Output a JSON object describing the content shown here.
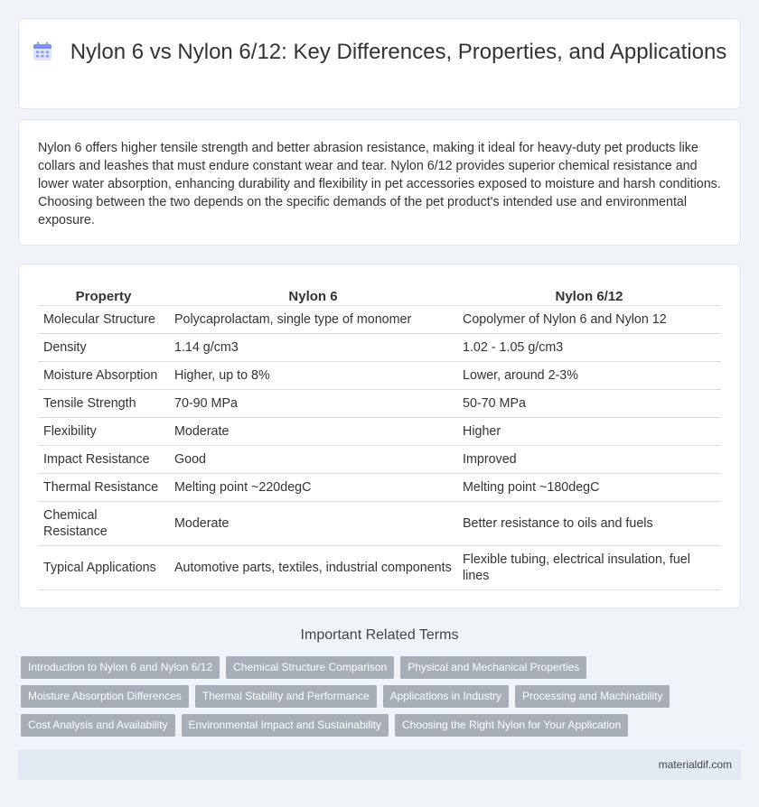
{
  "header": {
    "title": "Nylon 6 vs Nylon 6/12: Key Differences, Properties, and Applications",
    "icon": "calendar-icon"
  },
  "intro": "Nylon 6 offers higher tensile strength and better abrasion resistance, making it ideal for heavy-duty pet products like collars and leashes that must endure constant wear and tear. Nylon 6/12 provides superior chemical resistance and lower water absorption, enhancing durability and flexibility in pet accessories exposed to moisture and harsh conditions. Choosing between the two depends on the specific demands of the pet product's intended use and environmental exposure.",
  "table": {
    "headers": [
      "Property",
      "Nylon 6",
      "Nylon 6/12"
    ],
    "rows": [
      [
        "Molecular Structure",
        "Polycaprolactam, single type of monomer",
        "Copolymer of Nylon 6 and Nylon 12"
      ],
      [
        "Density",
        "1.14 g/cm3",
        "1.02 - 1.05 g/cm3"
      ],
      [
        "Moisture Absorption",
        "Higher, up to 8%",
        "Lower, around 2-3%"
      ],
      [
        "Tensile Strength",
        "70-90 MPa",
        "50-70 MPa"
      ],
      [
        "Flexibility",
        "Moderate",
        "Higher"
      ],
      [
        "Impact Resistance",
        "Good",
        "Improved"
      ],
      [
        "Thermal Resistance",
        "Melting point ~220degC",
        "Melting point ~180degC"
      ],
      [
        "Chemical Resistance",
        "Moderate",
        "Better resistance to oils and fuels"
      ],
      [
        "Typical Applications",
        "Automotive parts, textiles, industrial components",
        "Flexible tubing, electrical insulation, fuel lines"
      ]
    ]
  },
  "related": {
    "title": "Important Related Terms",
    "tags": [
      "Introduction to Nylon 6 and Nylon 6/12",
      "Chemical Structure Comparison",
      "Physical and Mechanical Properties",
      "Moisture Absorption Differences",
      "Thermal Stability and Performance",
      "Applications in Industry",
      "Processing and Machinability",
      "Cost Analysis and Availability",
      "Environmental Impact and Sustainability",
      "Choosing the Right Nylon for Your Application"
    ]
  },
  "footer": {
    "site": "materialdif.com"
  },
  "colors": {
    "icon_accent": "#7b8cf5",
    "tag_bg": "#a8aeb8",
    "page_bg": "#f0f3f8",
    "footer_bg": "#e4eaf4"
  }
}
